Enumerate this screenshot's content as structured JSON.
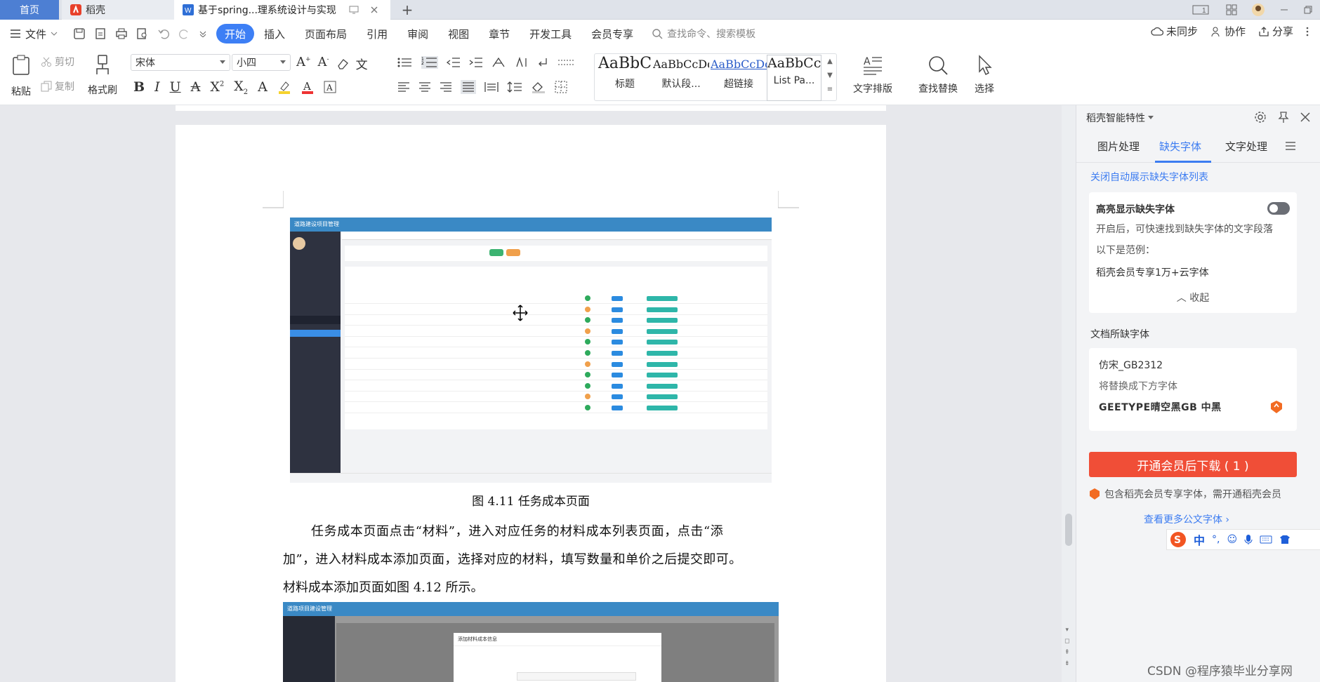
{
  "tabs": {
    "home": "首页",
    "daoke": "稻壳",
    "doc": "基于spring...理系统设计与实现"
  },
  "menu": {
    "file": "文件",
    "items": [
      "开始",
      "插入",
      "页面布局",
      "引用",
      "审阅",
      "视图",
      "章节",
      "开发工具",
      "会员专享"
    ],
    "search_placeholder": "查找命令、搜索模板",
    "sync": "未同步",
    "collab": "协作",
    "share": "分享"
  },
  "ribbon": {
    "paste": "粘贴",
    "cut": "剪切",
    "copy": "复制",
    "format_painter": "格式刷",
    "font_family": "宋体",
    "font_size": "小四",
    "styles": [
      {
        "sample": "AaBbC",
        "name": "标题"
      },
      {
        "sample": "AaBbCcDd",
        "name": "默认段..."
      },
      {
        "sample": "AaBbCcDd",
        "name": "超链接"
      },
      {
        "sample": "AaBbCcI",
        "name": "List Pa..."
      }
    ],
    "text_layout": "文字排版",
    "find_replace": "查找替换",
    "select": "选择"
  },
  "document": {
    "figure_caption": "图 4.11  任务成本页面",
    "para_line1": "任务成本页面点击“材料”，进入对应任务的材料成本列表页面，点击“添",
    "para_line2": "加”，进入材料成本添加页面，选择对应的材料，填写数量和单价之后提交即可。",
    "para_line3": "材料成本添加页面如图 4.12 所示。",
    "shot1_title": "道路建设项目管理",
    "shot2_title": "道路项目建设管理",
    "shot2_dialog_title": "添加材料成本信息"
  },
  "panel": {
    "header": "稻壳智能特性",
    "tabs": [
      "图片处理",
      "缺失字体",
      "文字处理"
    ],
    "active_tab": "缺失字体",
    "close_auto": "关闭自动展示缺失字体列表",
    "highlight_title": "高亮显示缺失字体",
    "highlight_desc": "开启后，可快速找到缺失字体的文字段落",
    "example_label": "以下是范例：",
    "example_text": "稻壳会员专享1万+云字体",
    "collapse": "收起",
    "missing_title": "文档所缺字体",
    "missing_font": "仿宋_GB2312",
    "replace_label": "将替换成下方字体",
    "replace_font": "GEETYPE晴空黑GB 中黑",
    "download_btn": "开通会员后下载 ( 1 )",
    "member_note": "包含稻壳会员专享字体，需开通稻壳会员",
    "more_fonts": "查看更多公文字体",
    "accent": "#f04e37",
    "link_color": "#3c7cf1"
  },
  "ime": {
    "lang": "中"
  },
  "watermark": "CSDN @程序猿毕业分享网"
}
